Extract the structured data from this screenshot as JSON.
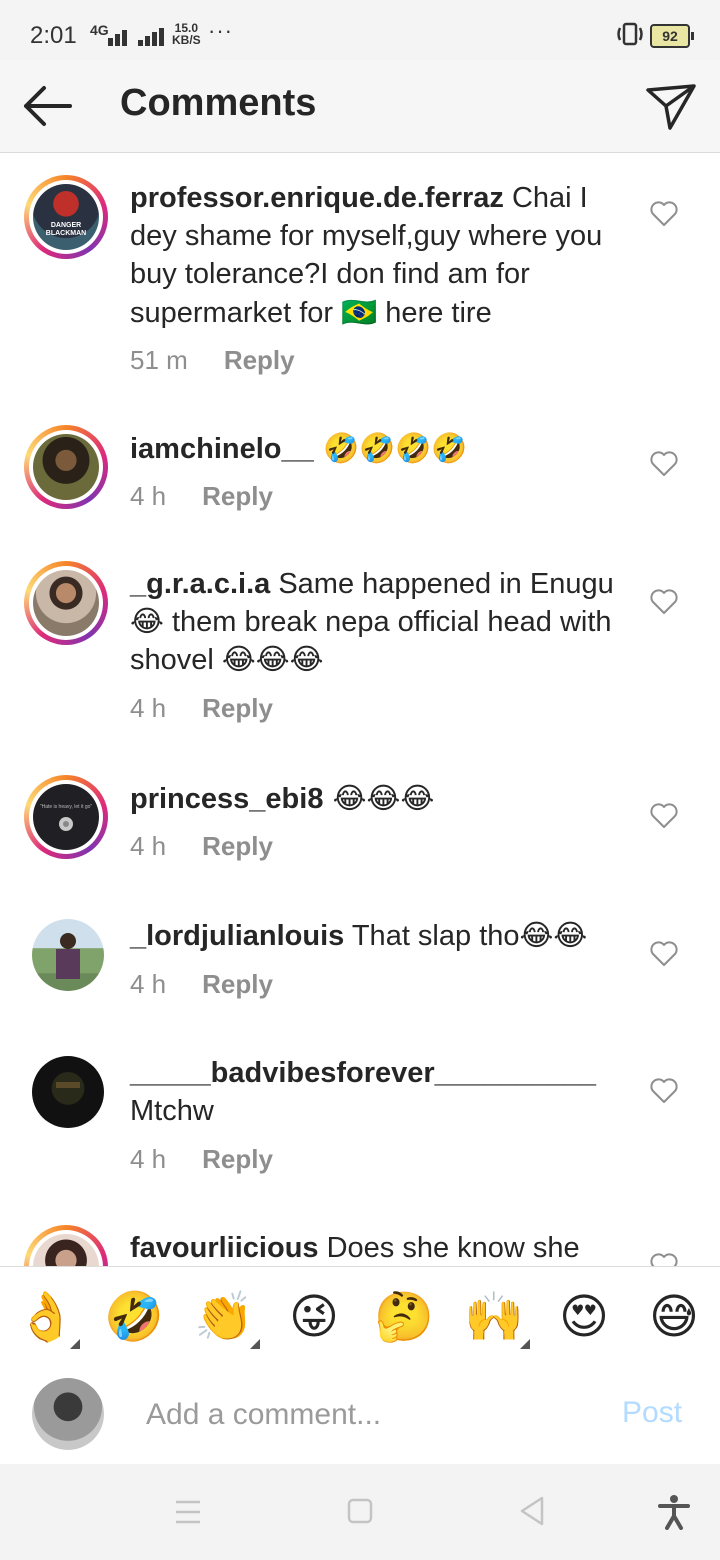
{
  "status_bar": {
    "time": "2:01",
    "network": "4G",
    "speed_value": "15.0",
    "speed_unit": "KB/S",
    "more": "···",
    "battery": "92"
  },
  "header": {
    "title": "Comments"
  },
  "comments": [
    {
      "username": "professor.enrique.de.ferraz",
      "text_before_flag": " Chai I dey shame for myself,guy where you buy tolerance?I don find am for supermarket  for ",
      "flag": "🇧🇷",
      "text_after_flag": " here tire",
      "time": "51 m",
      "reply": "Reply",
      "avatar_text": "DANGER BLACKMAN"
    },
    {
      "username": "iamchinelo__",
      "text": " 🤣🤣🤣🤣",
      "time": "4 h",
      "reply": "Reply"
    },
    {
      "username": "_g.r.a.c.i.a",
      "text": " Same happened in Enugu 😂 them break nepa official head with shovel 😂😂😂",
      "time": "4 h",
      "reply": "Reply"
    },
    {
      "username": "princess_ebi8",
      "text": " 😂😂😂",
      "time": "4 h",
      "reply": "Reply",
      "avatar_text": "\"Hate is heavy, let it go\""
    },
    {
      "username": "_lordjulianlouis",
      "text": " That slap tho😂😂",
      "time": "4 h",
      "reply": "Reply"
    },
    {
      "username": "_____badvibesforever__________",
      "text": " Mtchw",
      "time": "4 h",
      "reply": "Reply"
    },
    {
      "username": "favourliicious",
      "text": " Does she know she",
      "time": "",
      "reply": ""
    }
  ],
  "quick_emojis": [
    "👌",
    "🤣",
    "👏",
    "😜",
    "🤔",
    "🙌",
    "😍",
    "😅"
  ],
  "composer": {
    "placeholder": "Add a comment...",
    "post_label": "Post"
  },
  "colors": {
    "accent_disabled": "#b3dbff",
    "text_primary": "#262626",
    "text_secondary": "#8e8e8e"
  }
}
